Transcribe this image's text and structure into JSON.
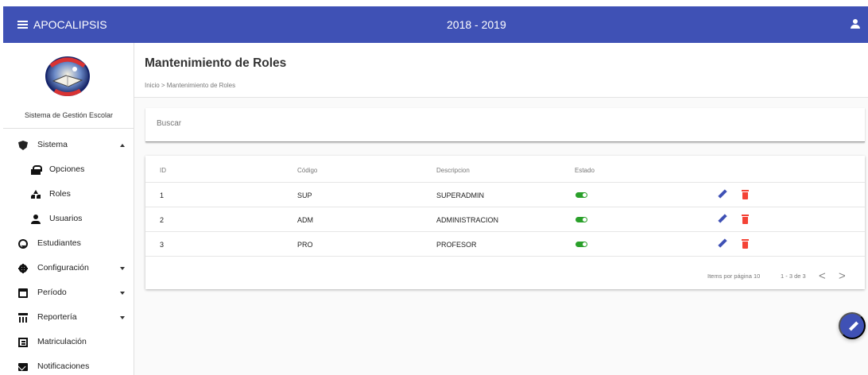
{
  "app": {
    "title": "APOCALIPSIS",
    "period": "2018 - 2019"
  },
  "sidebar": {
    "system_title": "Sistema de Gestión Escolar",
    "items": [
      {
        "label": "Sistema",
        "icon": "shield-icon"
      },
      {
        "label": "Opciones",
        "icon": "lock-icon"
      },
      {
        "label": "Roles",
        "icon": "roles-icon"
      },
      {
        "label": "Usuarios",
        "icon": "user-icon"
      },
      {
        "label": "Estudiantes",
        "icon": "face-icon"
      },
      {
        "label": "Configuración",
        "icon": "gear-icon"
      },
      {
        "label": "Período",
        "icon": "calendar-icon"
      },
      {
        "label": "Reportería",
        "icon": "table-icon"
      },
      {
        "label": "Matriculación",
        "icon": "document-icon"
      },
      {
        "label": "Notificaciones",
        "icon": "mail-icon"
      }
    ]
  },
  "main": {
    "title": "Mantenimiento de Roles",
    "breadcrumb": "Inicio > Mantenimiento de Roles",
    "search_placeholder": "Buscar",
    "table": {
      "headers": [
        "ID",
        "Código",
        "Descripcion",
        "Estado"
      ],
      "rows": [
        {
          "id": "1",
          "codigo": "SUP",
          "descripcion": "SUPERADMIN",
          "estado": "on"
        },
        {
          "id": "2",
          "codigo": "ADM",
          "descripcion": "ADMINISTRACION",
          "estado": "on"
        },
        {
          "id": "3",
          "codigo": "PRO",
          "descripcion": "PROFESOR",
          "estado": "on"
        }
      ]
    },
    "paginator": {
      "items_per_page": "Items por página 10",
      "range": "1 - 3 de 3",
      "prev": "<",
      "next": ">"
    }
  },
  "colors": {
    "primary": "#3f51b5",
    "success": "#2aa02a",
    "danger": "#f44336"
  }
}
